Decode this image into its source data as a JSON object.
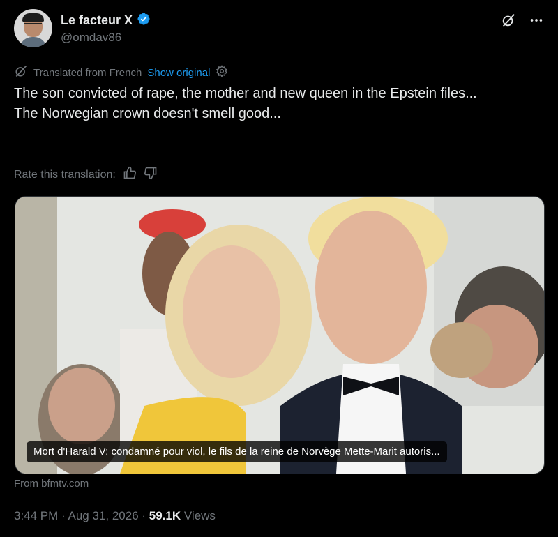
{
  "author": {
    "name": "Le facteur X",
    "handle": "@omdav86",
    "verified_color": "#1d9bf0"
  },
  "translation": {
    "label": "Translated from French",
    "show_original": "Show original",
    "rate_label": "Rate this translation:"
  },
  "tweet": {
    "text": "The son convicted of rape, the mother and new queen in the Epstein files...\nThe Norwegian crown doesn't smell good..."
  },
  "card": {
    "caption": "Mort d'Harald V: condamné pour viol, le fils de la reine de Norvège Mette-Marit autoris...",
    "source": "From bfmtv.com"
  },
  "meta": {
    "time": "3:44 PM",
    "date": "Aug 31, 2026",
    "views_count": "59.1K",
    "views_label": "Views"
  },
  "icons": {
    "verified": "verified-badge-icon",
    "grok": "grok-icon",
    "more": "more-icon",
    "translate": "translate-icon",
    "settings": "gear-icon",
    "thumbs_up": "thumbs-up-icon",
    "thumbs_down": "thumbs-down-icon"
  },
  "colors": {
    "background": "#000000",
    "text": "#e7e9ea",
    "muted": "#71767b",
    "accent": "#1d9bf0"
  }
}
